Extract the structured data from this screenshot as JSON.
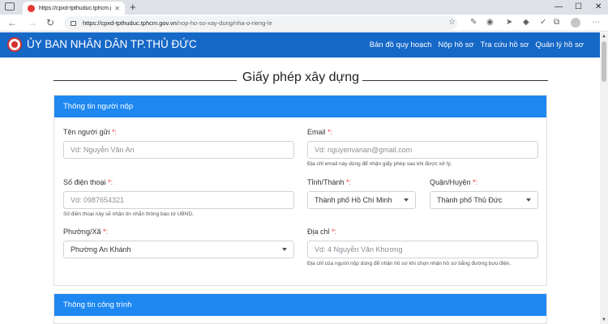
{
  "browser": {
    "tab_title": "https://cpxd-tpthuduc.tphcm.gov.vn/",
    "url_host": "https://cpxd-tpthuduc.tphcm.gov.vn",
    "url_path": "/nop-ho-so-xay-dung/nha-o-rieng-le"
  },
  "site": {
    "title": "ỦY BAN NHÂN DÂN TP.THỦ ĐỨC",
    "nav": [
      "Bản đồ quy hoạch",
      "Nộp hồ sơ",
      "Tra cứu hồ sơ",
      "Quản lý hồ sơ"
    ]
  },
  "page": {
    "heading": "Giấy phép xây dựng"
  },
  "form": {
    "section_title": "Thông tin người nộp",
    "sender_name": {
      "label": "Tên người gửi",
      "required": "*:",
      "placeholder": "Vd: Nguyễn Văn An"
    },
    "email": {
      "label": "Email",
      "required": "*:",
      "placeholder": "Vd: nguyenvanan@gmail.com",
      "help": "Địa chỉ email này dùng để nhận giấy phép sau khi được xử lý."
    },
    "phone": {
      "label": "Số điện thoại",
      "required": "*:",
      "placeholder": "Vd: 0987654321",
      "help": "Số điện thoại này sẽ nhận tin nhắn thông báo từ UBND."
    },
    "province": {
      "label": "Tỉnh/Thành",
      "required": "*:",
      "value": "Thành phố Hồ Chí Minh"
    },
    "district": {
      "label": "Quận/Huyện",
      "required": "*:",
      "value": "Thành phố Thủ Đức"
    },
    "ward": {
      "label": "Phường/Xã",
      "required": "*:",
      "value": "Phường An Khánh"
    },
    "address": {
      "label": "Địa chỉ",
      "required": "*:",
      "placeholder": "Vd: 4 Nguyễn Văn Khương",
      "help": "Địa chỉ của người nộp dùng để nhận hồ sơ khi chọn nhận hồ sơ bằng đường bưu điện."
    }
  },
  "section2": {
    "title": "Thông tin công trình"
  }
}
